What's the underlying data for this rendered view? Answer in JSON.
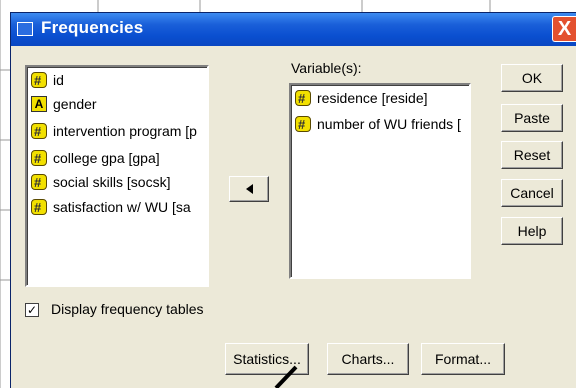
{
  "window": {
    "title": "Frequencies",
    "close_glyph": "X"
  },
  "source_list": {
    "items": [
      {
        "label": "id",
        "icon": "scale-variable-icon"
      },
      {
        "label": "gender",
        "icon": "nominal-variable-icon"
      },
      {
        "label": "intervention program [p",
        "icon": "scale-variable-icon"
      },
      {
        "label": "college gpa [gpa]",
        "icon": "scale-variable-icon"
      },
      {
        "label": "social skills [socsk]",
        "icon": "scale-variable-icon"
      },
      {
        "label": "satisfaction w/ WU [sa",
        "icon": "scale-variable-icon"
      }
    ]
  },
  "variables": {
    "label": "Variable(s):",
    "items": [
      {
        "label": "residence [reside]",
        "icon": "scale-variable-icon"
      },
      {
        "label": "number of WU friends [",
        "icon": "scale-variable-icon"
      }
    ]
  },
  "buttons": {
    "ok": "OK",
    "paste": "Paste",
    "reset": "Reset",
    "cancel": "Cancel",
    "help": "Help"
  },
  "bottom_buttons": {
    "statistics": "Statistics...",
    "charts": "Charts...",
    "format": "Format..."
  },
  "display_frequency": {
    "label": "Display frequency tables",
    "checked": true,
    "check_glyph": "✓"
  }
}
